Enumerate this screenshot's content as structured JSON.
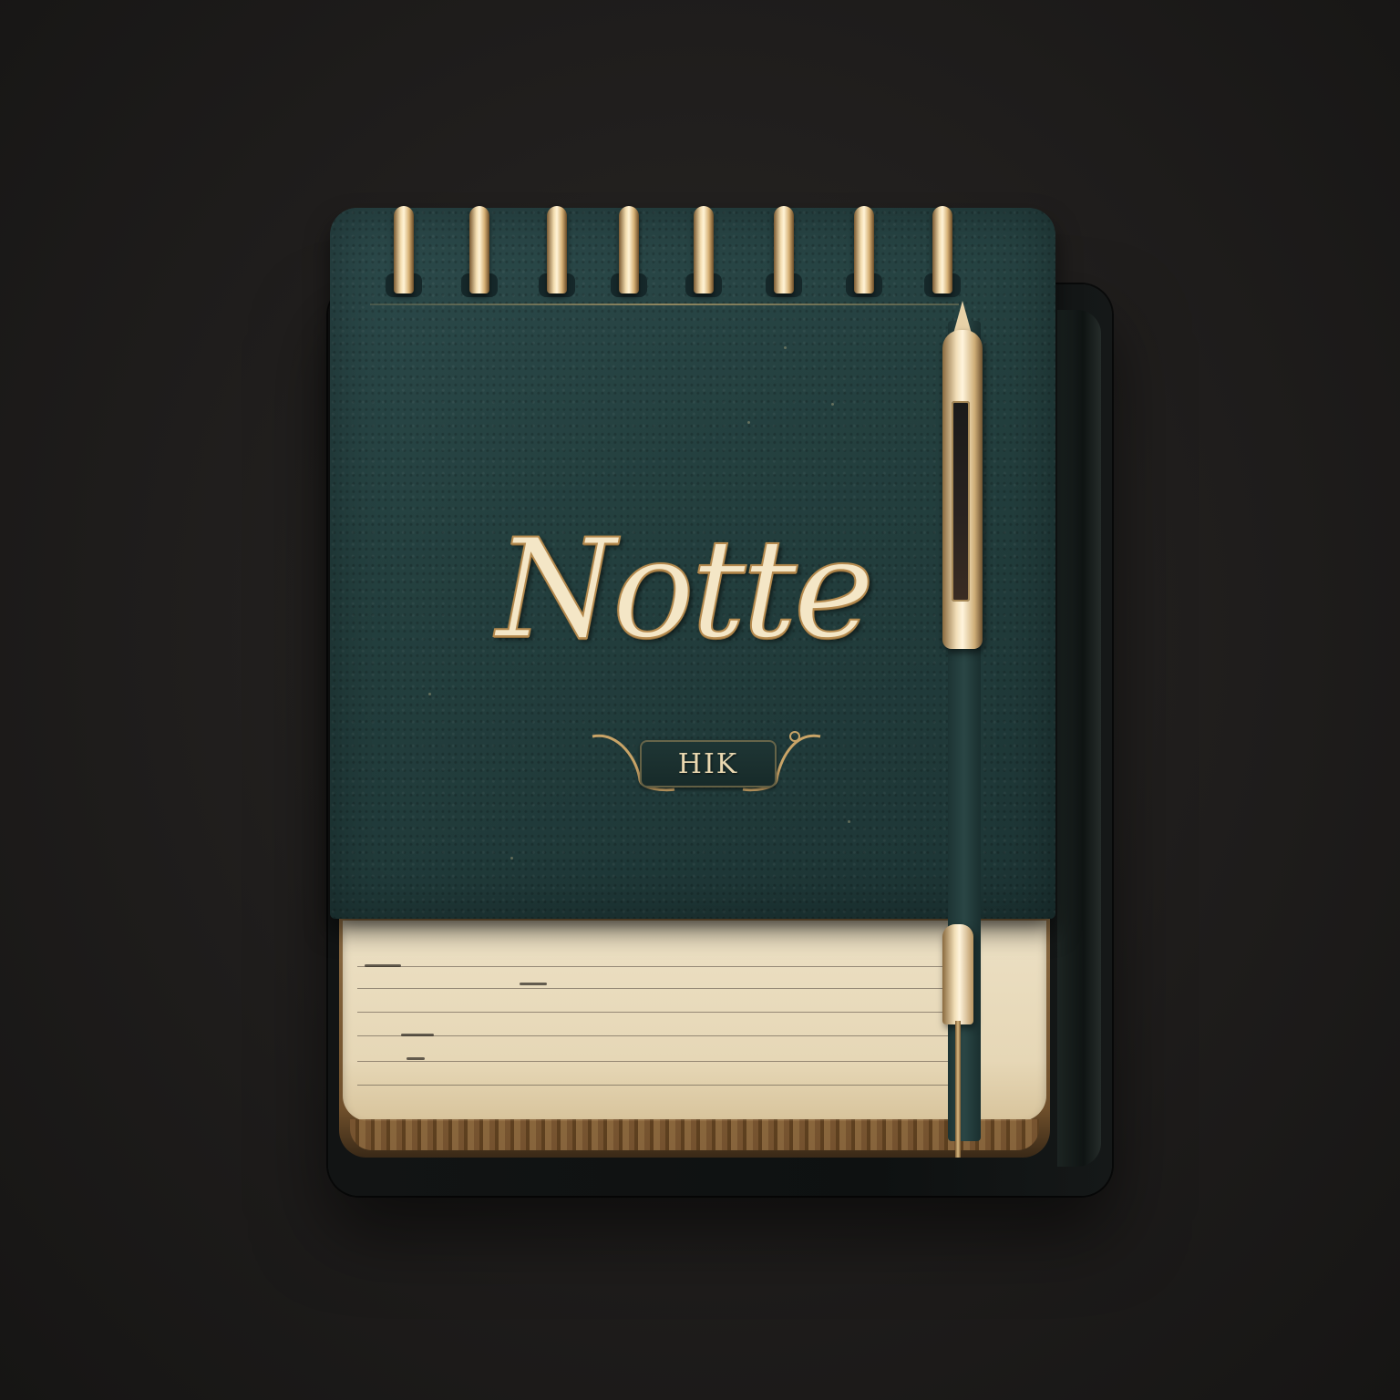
{
  "cover": {
    "title": "Notte",
    "label": "HIK"
  },
  "colors": {
    "background": "#1f1d1c",
    "cover": "#24403f",
    "gold": "#e8d2a8",
    "paper": "#e6d7b6"
  },
  "spiral_ring_count": 8
}
